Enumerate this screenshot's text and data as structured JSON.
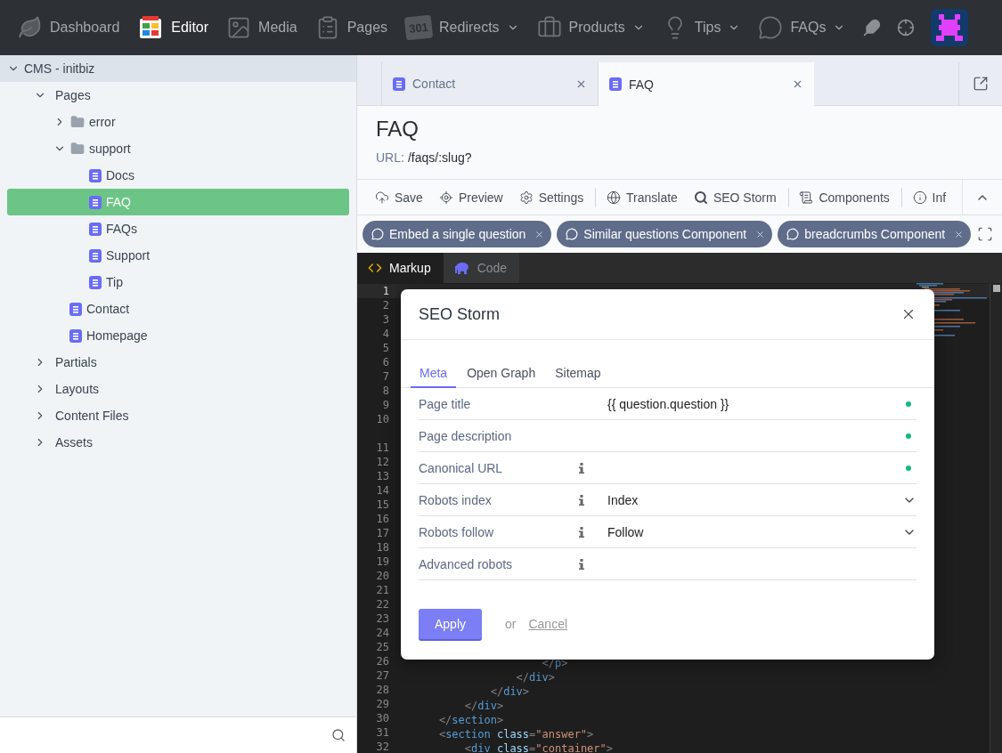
{
  "nav": {
    "items": [
      {
        "label": "Dashboard",
        "selected": false,
        "dropdown": false
      },
      {
        "label": "Editor",
        "selected": true,
        "dropdown": false
      },
      {
        "label": "Media",
        "selected": false,
        "dropdown": false
      },
      {
        "label": "Pages",
        "selected": false,
        "dropdown": false
      },
      {
        "label": "Redirects",
        "badge": "301",
        "selected": false,
        "dropdown": true
      },
      {
        "label": "Products",
        "selected": false,
        "dropdown": true
      },
      {
        "label": "Tips",
        "selected": false,
        "dropdown": true
      },
      {
        "label": "FAQs",
        "selected": false,
        "dropdown": true
      }
    ]
  },
  "sidebar": {
    "tree": [
      {
        "label": "CMS - initbiz",
        "kind": "root",
        "expanded": true,
        "selected": false,
        "children": [
          {
            "label": "Pages",
            "kind": "section",
            "expanded": true,
            "selected": false,
            "children": [
              {
                "label": "error",
                "kind": "folder",
                "expanded": false,
                "selected": false
              },
              {
                "label": "support",
                "kind": "folder",
                "expanded": true,
                "selected": false,
                "children": [
                  {
                    "label": "Docs",
                    "kind": "page",
                    "selected": false
                  },
                  {
                    "label": "FAQ",
                    "kind": "page",
                    "selected": true
                  },
                  {
                    "label": "FAQs",
                    "kind": "page",
                    "selected": false
                  },
                  {
                    "label": "Support",
                    "kind": "page",
                    "selected": false
                  },
                  {
                    "label": "Tip",
                    "kind": "page",
                    "selected": false
                  }
                ]
              },
              {
                "label": "Contact",
                "kind": "page",
                "selected": false
              },
              {
                "label": "Homepage",
                "kind": "page",
                "selected": false
              }
            ]
          },
          {
            "label": "Partials",
            "kind": "section",
            "expanded": false,
            "selected": false
          },
          {
            "label": "Layouts",
            "kind": "section",
            "expanded": false,
            "selected": false
          },
          {
            "label": "Content Files",
            "kind": "section",
            "expanded": false,
            "selected": false
          },
          {
            "label": "Assets",
            "kind": "section",
            "expanded": false,
            "selected": false
          }
        ]
      }
    ]
  },
  "tabs": [
    {
      "label": "Contact",
      "selected": false
    },
    {
      "label": "FAQ",
      "selected": true
    }
  ],
  "page": {
    "title": "FAQ",
    "url_label": "URL:",
    "url": "/faqs/:slug?"
  },
  "toolbar": [
    {
      "label": "Save",
      "divider_before": false
    },
    {
      "label": "Preview",
      "divider_before": false
    },
    {
      "label": "Settings",
      "divider_before": false
    },
    {
      "label": "Translate",
      "divider_before": true
    },
    {
      "label": "SEO Storm",
      "divider_before": false
    },
    {
      "label": "Components",
      "divider_before": true
    },
    {
      "label": "Inf",
      "divider_before": true
    }
  ],
  "components": [
    "Embed a single question",
    "Similar questions Component",
    "breadcrumbs Component"
  ],
  "editor_tabs": [
    {
      "label": "Markup",
      "selected": true
    },
    {
      "label": "Code",
      "selected": false
    }
  ],
  "code": {
    "lines": [
      {
        "number": "1",
        "active": true,
        "wrapped": false
      },
      {
        "number": "2",
        "active": false,
        "wrapped": false
      },
      {
        "number": "3",
        "active": false,
        "wrapped": false
      },
      {
        "number": "4",
        "active": false,
        "wrapped": false
      },
      {
        "number": "5",
        "active": false,
        "wrapped": false
      },
      {
        "number": "6",
        "active": false,
        "wrapped": false
      },
      {
        "number": "7",
        "active": false,
        "wrapped": false
      },
      {
        "number": "8",
        "active": false,
        "wrapped": false
      },
      {
        "number": "9",
        "active": false,
        "wrapped": false
      },
      {
        "number": "10",
        "active": false,
        "wrapped": true
      },
      {
        "number": "11",
        "active": false,
        "wrapped": false
      },
      {
        "number": "12",
        "active": false,
        "wrapped": false
      },
      {
        "number": "13",
        "active": false,
        "wrapped": false
      },
      {
        "number": "14",
        "active": false,
        "wrapped": false
      },
      {
        "number": "15",
        "active": false,
        "wrapped": false
      },
      {
        "number": "16",
        "active": false,
        "wrapped": false
      },
      {
        "number": "17",
        "active": false,
        "wrapped": false
      },
      {
        "number": "18",
        "active": false,
        "wrapped": false
      },
      {
        "number": "19",
        "active": false,
        "wrapped": false
      },
      {
        "number": "20",
        "active": false,
        "wrapped": false
      },
      {
        "number": "21",
        "active": false,
        "wrapped": false
      },
      {
        "number": "22",
        "active": false,
        "wrapped": false
      },
      {
        "number": "23",
        "active": false,
        "wrapped": false
      },
      {
        "number": "24",
        "active": false,
        "wrapped": false
      },
      {
        "number": "25",
        "active": false,
        "wrapped": false
      },
      {
        "number": "26",
        "active": false,
        "wrapped": false,
        "tokens": [
          {
            "kind": "punct",
            "text": "                    </"
          },
          {
            "kind": "tag",
            "text": "p"
          },
          {
            "kind": "punct",
            "text": ">"
          }
        ]
      },
      {
        "number": "27",
        "active": false,
        "wrapped": false,
        "tokens": [
          {
            "kind": "punct",
            "text": "                </"
          },
          {
            "kind": "tag",
            "text": "div"
          },
          {
            "kind": "punct",
            "text": ">"
          }
        ]
      },
      {
        "number": "28",
        "active": false,
        "wrapped": false,
        "tokens": [
          {
            "kind": "punct",
            "text": "            </"
          },
          {
            "kind": "tag",
            "text": "div"
          },
          {
            "kind": "punct",
            "text": ">"
          }
        ]
      },
      {
        "number": "29",
        "active": false,
        "wrapped": false,
        "tokens": [
          {
            "kind": "punct",
            "text": "        </"
          },
          {
            "kind": "tag",
            "text": "div"
          },
          {
            "kind": "punct",
            "text": ">"
          }
        ]
      },
      {
        "number": "30",
        "active": false,
        "wrapped": false,
        "tokens": [
          {
            "kind": "punct",
            "text": "    </"
          },
          {
            "kind": "tag",
            "text": "section"
          },
          {
            "kind": "punct",
            "text": ">"
          }
        ]
      },
      {
        "number": "31",
        "active": false,
        "wrapped": false,
        "tokens": [
          {
            "kind": "punct",
            "text": "    <"
          },
          {
            "kind": "tag",
            "text": "section"
          },
          {
            "kind": "attr",
            "text": " class"
          },
          {
            "kind": "punct",
            "text": "="
          },
          {
            "kind": "string",
            "text": "\"answer\""
          },
          {
            "kind": "punct",
            "text": ">"
          }
        ]
      },
      {
        "number": "32",
        "active": false,
        "wrapped": false,
        "tokens": [
          {
            "kind": "punct",
            "text": "        <"
          },
          {
            "kind": "tag",
            "text": "div"
          },
          {
            "kind": "attr",
            "text": " class"
          },
          {
            "kind": "punct",
            "text": "="
          },
          {
            "kind": "string",
            "text": "\"container\""
          },
          {
            "kind": "punct",
            "text": ">"
          }
        ]
      }
    ]
  },
  "modal": {
    "title": "SEO Storm",
    "tabs": [
      {
        "label": "Meta",
        "selected": true
      },
      {
        "label": "Open Graph",
        "selected": false
      },
      {
        "label": "Sitemap",
        "selected": false
      }
    ],
    "fields": [
      {
        "label": "Page title",
        "kind": "text",
        "info": false,
        "value": "{{ question.question }}"
      },
      {
        "label": "Page description",
        "kind": "text",
        "info": false
      },
      {
        "label": "Canonical URL",
        "kind": "text",
        "info": true
      },
      {
        "label": "Robots index",
        "kind": "select",
        "info": true,
        "value": "Index"
      },
      {
        "label": "Robots follow",
        "kind": "select",
        "info": true,
        "value": "Follow"
      },
      {
        "label": "Advanced robots",
        "kind": "empty",
        "info": true
      }
    ],
    "apply": "Apply",
    "or": "or",
    "cancel": "Cancel"
  }
}
